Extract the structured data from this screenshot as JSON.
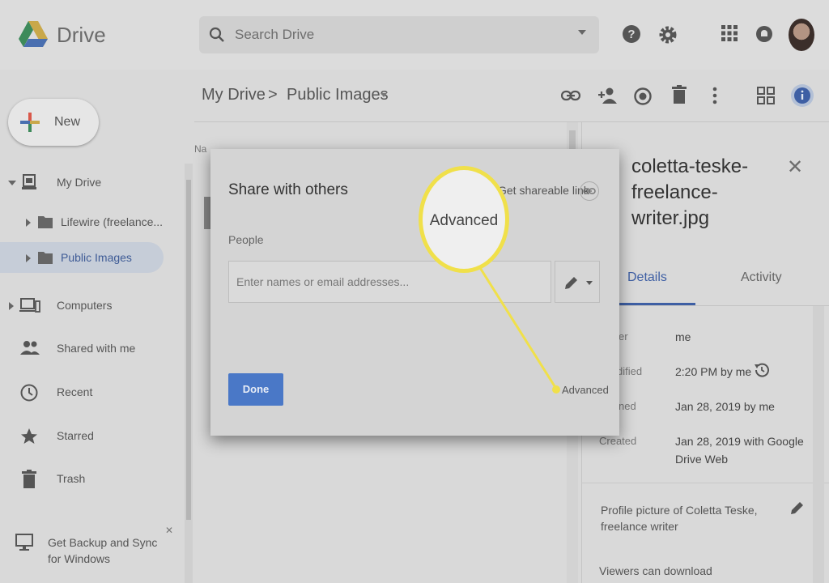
{
  "app": {
    "name": "Drive"
  },
  "search": {
    "placeholder": "Search Drive"
  },
  "sidebar": {
    "new_label": "New",
    "items": [
      {
        "label": "My Drive"
      },
      {
        "label": "Lifewire (freelance..."
      },
      {
        "label": "Public Images"
      },
      {
        "label": "Computers"
      },
      {
        "label": "Shared with me"
      },
      {
        "label": "Recent"
      },
      {
        "label": "Starred"
      },
      {
        "label": "Trash"
      }
    ],
    "backup_label": "Get Backup and Sync for Windows"
  },
  "breadcrumb": {
    "root": "My Drive",
    "separator": ">",
    "current": "Public Images"
  },
  "list": {
    "header_fragment": "Na"
  },
  "details": {
    "filename": "coletta-teske-freelance-writer.jpg",
    "tabs": [
      "Details",
      "Activity"
    ],
    "rows": [
      {
        "label": "er",
        "value": "me"
      },
      {
        "label": "dified",
        "value": "2:20 PM by me"
      },
      {
        "label": "ned",
        "value": "Jan 28, 2019 by me"
      },
      {
        "label": "Created",
        "value": "Jan 28, 2019 with Google Drive Web"
      }
    ],
    "description": "Profile picture of Coletta Teske, freelance writer",
    "viewers": "Viewers can download"
  },
  "modal": {
    "title": "Share with others",
    "shareable_link": "Get shareable link",
    "people_label": "People",
    "email_placeholder": "Enter names or email addresses...",
    "done_label": "Done",
    "advanced_label": "Advanced"
  },
  "callout": {
    "label": "Advanced",
    "color": "#f0e04a"
  }
}
